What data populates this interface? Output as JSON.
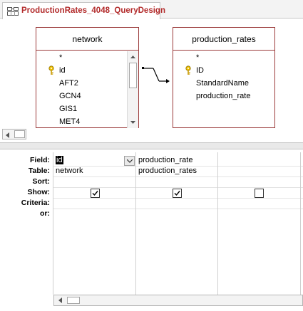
{
  "tab": {
    "title": "ProductionRates_4048_QueryDesign",
    "icon": "query-design-icon"
  },
  "tables": [
    {
      "name": "network",
      "fields": [
        "*",
        "id",
        "AFT2",
        "GCN4",
        "GIS1",
        "MET4"
      ],
      "key_field_index": 1
    },
    {
      "name": "production_rates",
      "fields": [
        "*",
        "ID",
        "StandardName",
        "production_rate"
      ],
      "key_field_index": 1
    }
  ],
  "grid": {
    "row_labels": [
      "Field:",
      "Table:",
      "Sort:",
      "Show:",
      "Criteria:",
      "or:"
    ],
    "columns": [
      {
        "field": "id",
        "table": "network",
        "sort": "",
        "show": true
      },
      {
        "field": "production_rate",
        "table": "production_rates",
        "sort": "",
        "show": true
      },
      {
        "field": "",
        "table": "",
        "sort": "",
        "show": false
      }
    ]
  },
  "colors": {
    "accent": "#b22a2a",
    "table_border": "#9b3a3a"
  }
}
